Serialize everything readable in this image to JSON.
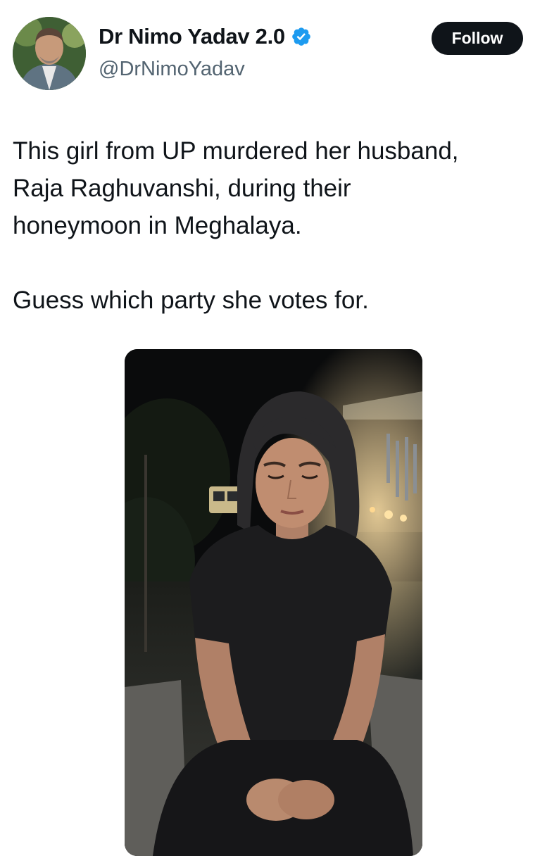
{
  "author": {
    "display_name": "Dr Nimo Yadav 2.0",
    "handle": "@DrNimoYadav",
    "verified": true
  },
  "follow_label": "Follow",
  "tweet": {
    "text_lines": [
      "This girl from UP murdered her husband,",
      "Raja Raghuvanshi, during their",
      "honeymoon in Meghalaya.",
      "",
      "Guess which party she votes for."
    ]
  },
  "colors": {
    "verified_blue": "#1d9bf0",
    "text_primary": "#0f1419",
    "text_secondary": "#536471",
    "button_bg": "#0f1419"
  }
}
